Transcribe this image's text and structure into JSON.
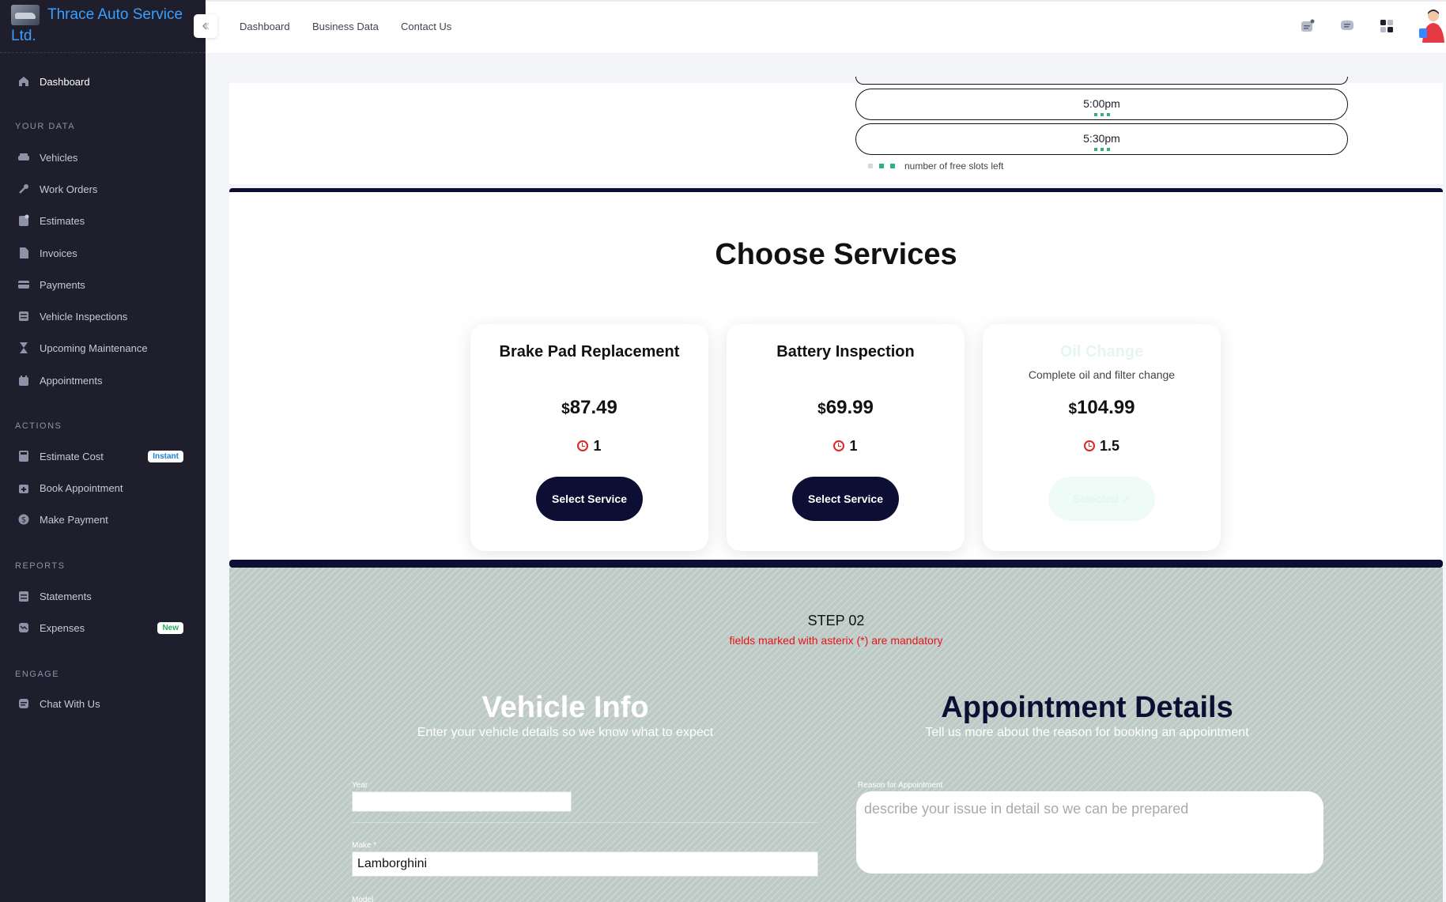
{
  "brand": {
    "title": "Thrace Auto Service Ltd."
  },
  "sidebar": {
    "dashboard": "Dashboard",
    "sections": {
      "your_data": "YOUR DATA",
      "actions": "ACTIONS",
      "reports": "REPORTS",
      "engage": "ENGAGE"
    },
    "your_data": [
      "Vehicles",
      "Work Orders",
      "Estimates",
      "Invoices",
      "Payments",
      "Vehicle Inspections",
      "Upcoming Maintenance",
      "Appointments"
    ],
    "actions": [
      "Estimate Cost",
      "Book Appointment",
      "Make Payment"
    ],
    "reports": [
      "Statements",
      "Expenses"
    ],
    "engage": [
      "Chat With Us"
    ],
    "badges": {
      "instant": "Instant",
      "new": "New"
    }
  },
  "topbar": {
    "links": [
      "Dashboard",
      "Business Data",
      "Contact Us"
    ]
  },
  "slots": {
    "times": [
      "5:00pm",
      "5:30pm"
    ],
    "legend": "number of free slots left"
  },
  "services": {
    "title": "Choose Services",
    "currency": "$",
    "cards": [
      {
        "name": "Brake Pad Replacement",
        "description": "",
        "price": "87.49",
        "hours": "1",
        "button": "Select Service"
      },
      {
        "name": "Battery Inspection",
        "description": "",
        "price": "69.99",
        "hours": "1",
        "button": "Select Service"
      },
      {
        "name": "Oil Change",
        "description": "Complete oil and filter change",
        "price": "104.99",
        "hours": "1.5",
        "button": "Selected ✓"
      }
    ]
  },
  "step": {
    "label": "STEP 02",
    "note": "fields marked with asterix (*) are mandatory",
    "vehicle": {
      "title": "Vehicle Info",
      "subtitle": "Enter your vehicle details so we know what to expect",
      "year_label": "Year",
      "year_value": "",
      "make_label": "Make *",
      "make_value": "Lamborghini",
      "model_label": "Model"
    },
    "appointment": {
      "title": "Appointment Details",
      "subtitle": "Tell us more about the reason for booking an appointment",
      "reason_label": "Reason for Appointment",
      "reason_placeholder": "describe your issue in detail so we can be prepared"
    }
  },
  "colors": {
    "sidebar_bg": "#1e1e2d",
    "brand_blue": "#3aa0ff",
    "navy": "#0c0f33",
    "mandatory_red": "#e5141b",
    "slot_green": "#2fb37a"
  }
}
